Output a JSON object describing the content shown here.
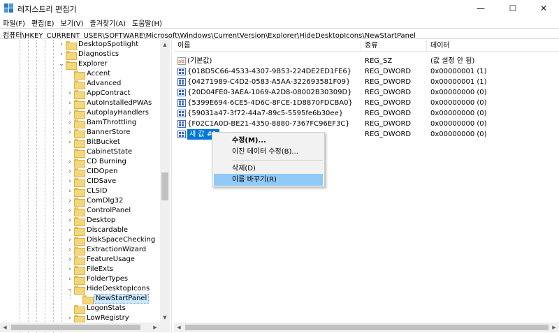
{
  "window": {
    "title": "레지스트리 편집기",
    "minimize_glyph": "—",
    "maximize_glyph": "☐",
    "close_glyph": "✕"
  },
  "menu": [
    {
      "label": "파일(F)"
    },
    {
      "label": "편집(E)"
    },
    {
      "label": "보기(V)"
    },
    {
      "label": "즐겨찾기(A)"
    },
    {
      "label": "도움말(H)"
    }
  ],
  "address": "컴퓨터\\HKEY_CURRENT_USER\\SOFTWARE\\Microsoft\\Windows\\CurrentVersion\\Explorer\\HideDesktopIcons\\NewStartPanel",
  "tree": {
    "items": [
      {
        "label": "DesktopSpotlight",
        "expander": "›",
        "level": 0
      },
      {
        "label": "Diagnostics",
        "expander": "›",
        "level": 0
      },
      {
        "label": "Explorer",
        "expander": "⌄",
        "level": 0
      },
      {
        "label": "Accent",
        "expander": "",
        "level": 1
      },
      {
        "label": "Advanced",
        "expander": "",
        "level": 1
      },
      {
        "label": "AppContract",
        "expander": "›",
        "level": 1
      },
      {
        "label": "AutoInstalledPWAs",
        "expander": "›",
        "level": 1
      },
      {
        "label": "AutoplayHandlers",
        "expander": "›",
        "level": 1
      },
      {
        "label": "BamThrottling",
        "expander": "›",
        "level": 1
      },
      {
        "label": "BannerStore",
        "expander": "›",
        "level": 1
      },
      {
        "label": "BitBucket",
        "expander": "›",
        "level": 1
      },
      {
        "label": "CabinetState",
        "expander": "",
        "level": 1
      },
      {
        "label": "CD Burning",
        "expander": "›",
        "level": 1
      },
      {
        "label": "CIDOpen",
        "expander": "›",
        "level": 1
      },
      {
        "label": "CIDSave",
        "expander": "›",
        "level": 1
      },
      {
        "label": "CLSID",
        "expander": "›",
        "level": 1
      },
      {
        "label": "ComDlg32",
        "expander": "›",
        "level": 1
      },
      {
        "label": "ControlPanel",
        "expander": "›",
        "level": 1
      },
      {
        "label": "Desktop",
        "expander": "›",
        "level": 1
      },
      {
        "label": "Discardable",
        "expander": "›",
        "level": 1
      },
      {
        "label": "DiskSpaceChecking",
        "expander": "›",
        "level": 1
      },
      {
        "label": "ExtractionWizard",
        "expander": "›",
        "level": 1
      },
      {
        "label": "FeatureUsage",
        "expander": "›",
        "level": 1
      },
      {
        "label": "FileExts",
        "expander": "›",
        "level": 1
      },
      {
        "label": "FolderTypes",
        "expander": "›",
        "level": 1
      },
      {
        "label": "HideDesktopIcons",
        "expander": "⌄",
        "level": 1
      },
      {
        "label": "NewStartPanel",
        "expander": "",
        "level": 2,
        "selected": true
      },
      {
        "label": "LogonStats",
        "expander": "",
        "level": 1
      },
      {
        "label": "LowRegistry",
        "expander": "›",
        "level": 1
      }
    ]
  },
  "list": {
    "columns": [
      {
        "label": "이름"
      },
      {
        "label": "종류"
      },
      {
        "label": "데이터"
      }
    ],
    "rows": [
      {
        "name": "(기본값)",
        "type": "REG_SZ",
        "data": "(값 설정 안 됨)",
        "icon": "string-value-icon"
      },
      {
        "name": "{018D5C66-4533-4307-9B53-224DE2ED1FE6}",
        "type": "REG_DWORD",
        "data": "0x00000001 (1)",
        "icon": "dword-value-icon"
      },
      {
        "name": "{04271989-C4D2-0583-A5AA-322693581F09}",
        "type": "REG_DWORD",
        "data": "0x00000001 (1)",
        "icon": "dword-value-icon"
      },
      {
        "name": "{20D04FE0-3AEA-1069-A2D8-08002B30309D}",
        "type": "REG_DWORD",
        "data": "0x00000000 (0)",
        "icon": "dword-value-icon"
      },
      {
        "name": "{5399E694-6CE5-4D6C-8FCE-1D8870FDCBA0}",
        "type": "REG_DWORD",
        "data": "0x00000000 (0)",
        "icon": "dword-value-icon"
      },
      {
        "name": "{59031a47-3f72-44a7-89c5-5595fe6b30ee}",
        "type": "REG_DWORD",
        "data": "0x00000000 (0)",
        "icon": "dword-value-icon"
      },
      {
        "name": "{F02C1A0D-BE21-4350-8880-7367FC96EF3C}",
        "type": "REG_DWORD",
        "data": "0x00000000 (0)",
        "icon": "dword-value-icon"
      },
      {
        "name": "새 값 #1",
        "type": "REG_DWORD",
        "data": "0x00000000 (0)",
        "icon": "dword-value-icon",
        "editing": true
      }
    ]
  },
  "context_menu": {
    "items": [
      {
        "label": "수정(M)...",
        "bold": true
      },
      {
        "label": "이진 데이터 수정(B)..."
      },
      {
        "separator": true
      },
      {
        "label": "삭제(D)"
      },
      {
        "label": "이름 바꾸기(R)",
        "hover": true
      }
    ]
  },
  "colors": {
    "selection": "#0078d7",
    "menu_hover": "#91c9f7",
    "tree_selected": "#cce8ff",
    "folder": "#f5d77b",
    "dword_icon": "#3b64c8",
    "string_icon": "#d24726"
  }
}
